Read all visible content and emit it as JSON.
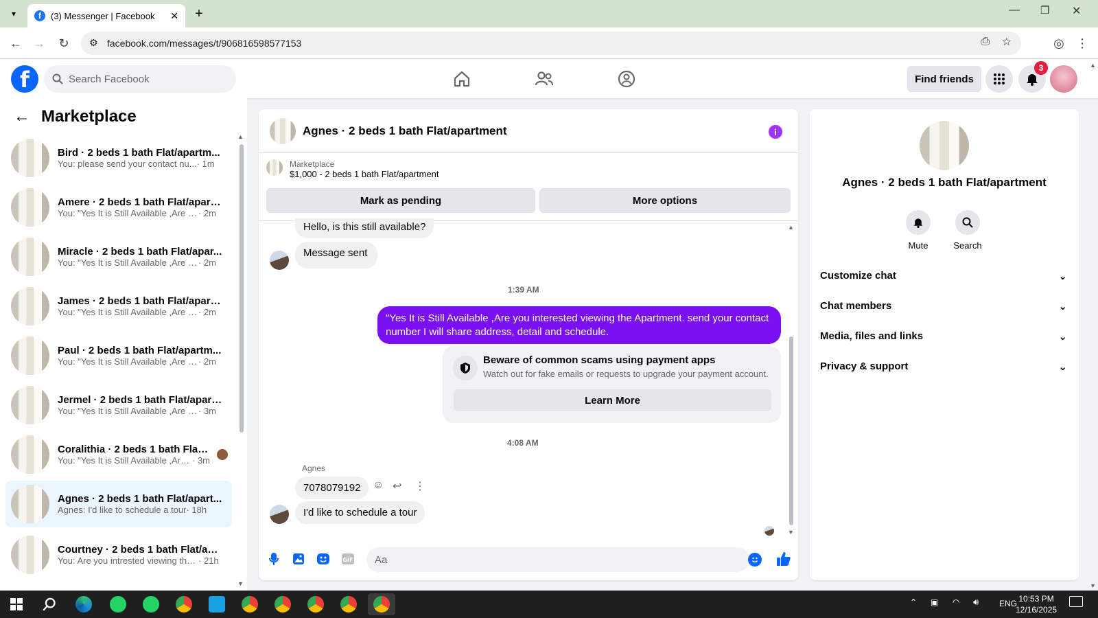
{
  "browser": {
    "tab_title": "(3) Messenger | Facebook",
    "url": "facebook.com/messages/t/906816598577153"
  },
  "header": {
    "search_placeholder": "Search Facebook",
    "find_friends": "Find friends",
    "notification_count": "3"
  },
  "sidebar": {
    "title": "Marketplace",
    "conversations": [
      {
        "name": "Bird · 2 beds 1 bath Flat/apartm...",
        "preview": "You: please send your contact nu...",
        "time": "· 1m"
      },
      {
        "name": "Amere · 2 beds 1 bath Flat/apart...",
        "preview": "You: \"Yes It is Still Available ,Are yo...",
        "time": "· 2m"
      },
      {
        "name": "Miracle · 2 beds 1 bath Flat/apar...",
        "preview": "You: \"Yes It is Still Available ,Are yo...",
        "time": "· 2m"
      },
      {
        "name": "James · 2 beds 1 bath Flat/apart...",
        "preview": "You: \"Yes It is Still Available ,Are yo...",
        "time": "· 2m"
      },
      {
        "name": "Paul · 2 beds 1 bath Flat/apartm...",
        "preview": "You: \"Yes It is Still Available ,Are yo...",
        "time": "· 2m"
      },
      {
        "name": "Jermel · 2 beds 1 bath Flat/apart...",
        "preview": "You: \"Yes It is Still Available ,Are yo...",
        "time": "· 3m"
      },
      {
        "name": "Coralithia · 2 beds 1 bath Flat/...",
        "preview": "You: \"Yes It is Still Available ,Are ...",
        "time": "· 3m"
      },
      {
        "name": "Agnes · 2 beds 1 bath Flat/apart...",
        "preview": "Agnes: I'd like to schedule a tour",
        "time": "· 18h"
      },
      {
        "name": "Courtney · 2 beds 1 bath Flat/ap...",
        "preview": "You: Are you intrested viewing the...",
        "time": "· 21h"
      }
    ]
  },
  "chat": {
    "title": "Agnes · 2 beds 1 bath Flat/apartment",
    "listing_label": "Marketplace",
    "listing_detail": "$1,000 - 2 beds 1 bath Flat/apartment",
    "mark_pending": "Mark as pending",
    "more_options": "More options",
    "messages": {
      "m1": "Hello, is this still available?",
      "m2": "Message sent",
      "time1": "1:39 AM",
      "mine": "\"Yes It is Still Available ,Are you interested viewing the Apartment. send your contact number I will share address, detail and schedule.",
      "scam_title": "Beware of common scams using payment apps",
      "scam_body": "Watch out for fake emails or requests to upgrade your payment account.",
      "learn_more": "Learn More",
      "time2": "4:08 AM",
      "sender_name": "Agnes",
      "m3": "7078079192",
      "m4": "I'd like to schedule a tour"
    },
    "composer_placeholder": "Aa"
  },
  "details": {
    "name": "Agnes · 2 beds 1 bath Flat/apartment",
    "mute": "Mute",
    "search": "Search",
    "sections": [
      "Customize chat",
      "Chat members",
      "Media, files and links",
      "Privacy & support"
    ]
  },
  "taskbar": {
    "lang": "ENG",
    "time": "10:53 PM",
    "date": "12/16/2025"
  }
}
